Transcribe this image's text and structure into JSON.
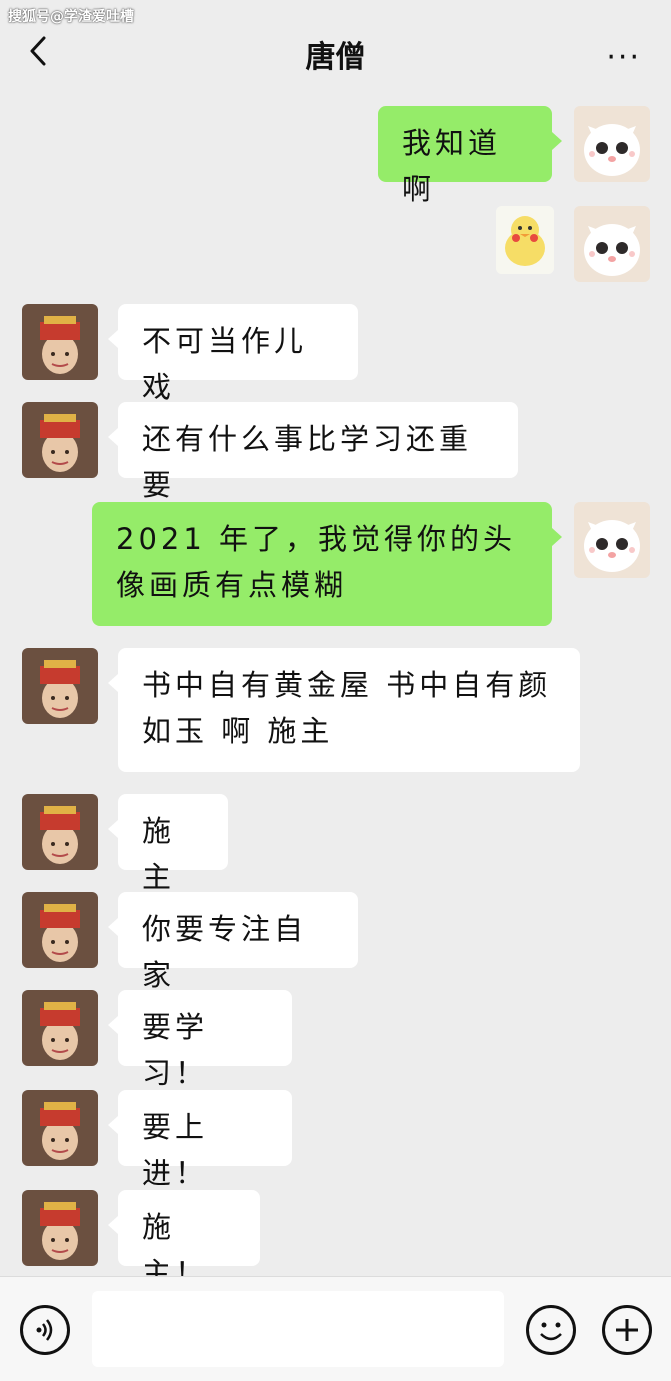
{
  "watermark": "搜狐号@学渣爱吐槽",
  "header": {
    "title": "唐僧"
  },
  "messages": [
    {
      "side": "right",
      "type": "text",
      "text": "我知道啊"
    },
    {
      "side": "right",
      "type": "sticker"
    },
    {
      "side": "left",
      "type": "text",
      "text": "不可当作儿戏"
    },
    {
      "side": "left",
      "type": "text",
      "text": "还有什么事比学习还重要"
    },
    {
      "side": "right",
      "type": "text",
      "text": "2021 年了，我觉得你的头像画质有点模糊"
    },
    {
      "side": "left",
      "type": "text",
      "text": "书中自有黄金屋 书中自有颜如玉 啊 施主"
    },
    {
      "side": "left",
      "type": "text",
      "text": "施主"
    },
    {
      "side": "left",
      "type": "text",
      "text": "你要专注自家"
    },
    {
      "side": "left",
      "type": "text",
      "text": "要学习！"
    },
    {
      "side": "left",
      "type": "text",
      "text": "要上进！"
    },
    {
      "side": "left",
      "type": "text",
      "text": "施主！"
    }
  ],
  "icons": {
    "back": "chevron-left-icon",
    "more": "more-icon",
    "voice": "voice-icon",
    "emoji": "emoji-icon",
    "plus": "plus-icon"
  },
  "colors": {
    "background": "#ededed",
    "right_bubble": "#95ec69",
    "left_bubble": "#ffffff"
  }
}
